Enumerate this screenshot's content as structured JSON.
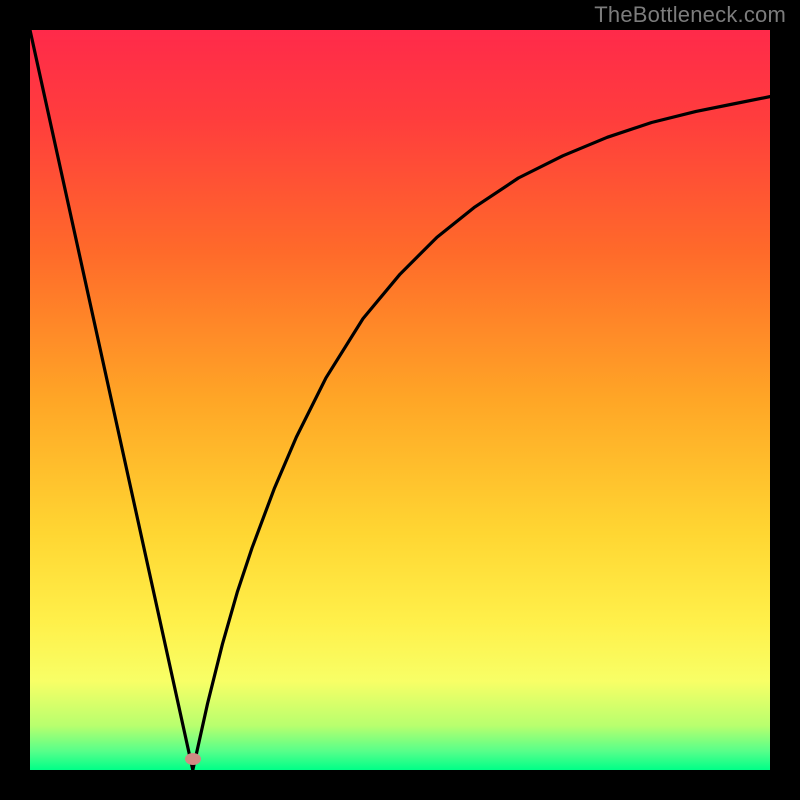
{
  "watermark": "TheBottleneck.com",
  "chart_data": {
    "type": "line",
    "title": "",
    "xlabel": "",
    "ylabel": "",
    "xlim": [
      0,
      100
    ],
    "ylim": [
      0,
      100
    ],
    "gradient_stops": [
      {
        "offset": 0,
        "color": "#ff2a4a"
      },
      {
        "offset": 0.12,
        "color": "#ff3d3d"
      },
      {
        "offset": 0.3,
        "color": "#ff6a2a"
      },
      {
        "offset": 0.5,
        "color": "#ffa626"
      },
      {
        "offset": 0.68,
        "color": "#ffd632"
      },
      {
        "offset": 0.8,
        "color": "#fff04a"
      },
      {
        "offset": 0.88,
        "color": "#f8ff66"
      },
      {
        "offset": 0.94,
        "color": "#b8ff6e"
      },
      {
        "offset": 0.975,
        "color": "#56ff8a"
      },
      {
        "offset": 1.0,
        "color": "#00ff88"
      }
    ],
    "marker": {
      "x": 22,
      "y": 1.5,
      "color": "#d08b84"
    },
    "series": [
      {
        "name": "left-descent",
        "x": [
          0,
          22
        ],
        "y": [
          100,
          0
        ]
      },
      {
        "name": "right-curve",
        "x": [
          22,
          24,
          26,
          28,
          30,
          33,
          36,
          40,
          45,
          50,
          55,
          60,
          66,
          72,
          78,
          84,
          90,
          95,
          100
        ],
        "y": [
          0,
          9,
          17,
          24,
          30,
          38,
          45,
          53,
          61,
          67,
          72,
          76,
          80,
          83,
          85.5,
          87.5,
          89,
          90,
          91
        ]
      }
    ]
  }
}
